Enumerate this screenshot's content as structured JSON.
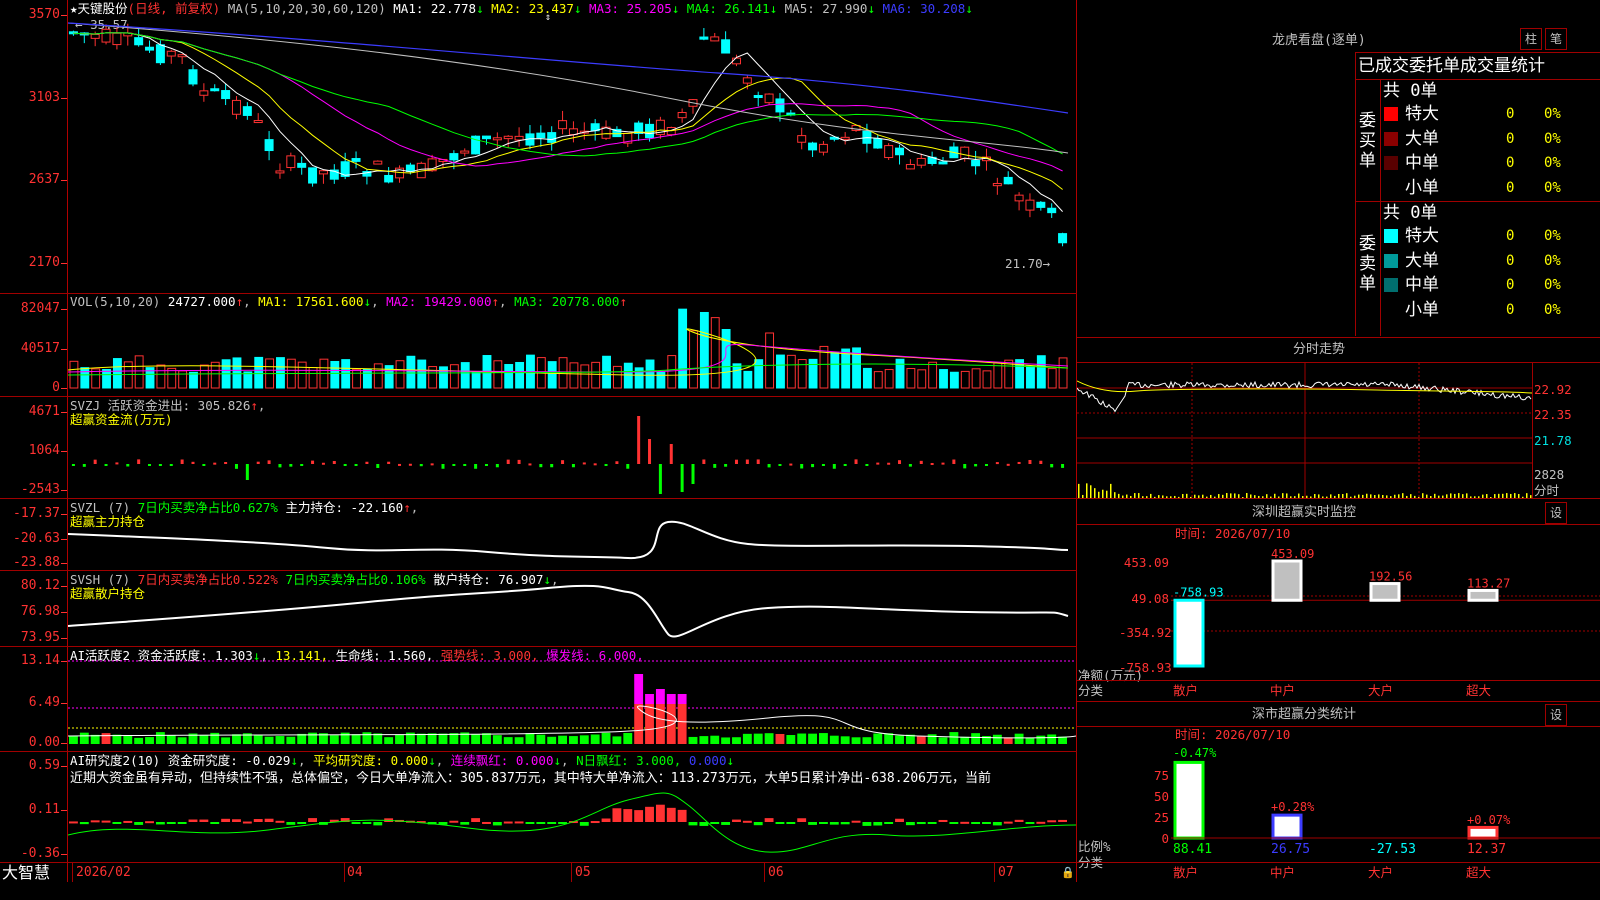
{
  "stock": {
    "name": "天键股份",
    "mode": "(日线, 前复权)",
    "ma_params": "MA(5,10,20,30,60,120)",
    "ma": [
      {
        "label": "MA1:",
        "value": "22.778",
        "arrow": "↓",
        "color": "#ffffff"
      },
      {
        "label": "MA2:",
        "value": "23.437",
        "arrow": "↓",
        "color": "#ffff00"
      },
      {
        "label": "MA3:",
        "value": "25.205",
        "arrow": "↓",
        "color": "#ff00ff"
      },
      {
        "label": "MA4:",
        "value": "26.141",
        "arrow": "↓",
        "color": "#00ff00"
      },
      {
        "label": "MA5:",
        "value": "27.990",
        "arrow": "↓",
        "color": "#c0c0c0"
      },
      {
        "label": "MA6:",
        "value": "30.208",
        "arrow": "↓",
        "color": "#3c3cff"
      }
    ],
    "high_mark": "35.57",
    "low_mark": "21.70→"
  },
  "main_axis": [
    "3570",
    "3103",
    "2637",
    "2170"
  ],
  "vol": {
    "header": "VOL(5,10,20)",
    "value": "24727.000",
    "ma1": "MA1: 17561.600",
    "ma2": "MA2: 19429.000",
    "ma3": "MA3: 20778.000",
    "axis": [
      "82047",
      "40517",
      "0"
    ]
  },
  "svzj": {
    "header": "SVZJ  活跃资金进出: 305.826",
    "title": "超赢资金流(万元)",
    "axis": [
      "4671",
      "1064",
      "-2543"
    ]
  },
  "svzl": {
    "header_a": "SVZL (7)",
    "header_b": "7日内买卖净占比0.627%",
    "header_c": "主力持仓: -22.160",
    "title": "超赢主力持仓",
    "axis": [
      "-17.37",
      "-20.63",
      "-23.88"
    ]
  },
  "svsh": {
    "header_a": "SVSH (7)",
    "header_b": "7日内买卖净占比0.522%",
    "header_c": "7日内买卖净占比0.106%",
    "header_d": "散户持仓: 76.907",
    "title": "超赢散户持仓",
    "axis": [
      "80.12",
      "76.98",
      "73.95"
    ]
  },
  "ai_active": {
    "a": "AI活跃度2 资金活跃度: 1.303",
    "b": "13.141,",
    "c": "生命线: 1.560,",
    "d": "强势线: 3.000,",
    "e": "爆发线: 6.000,",
    "axis": [
      "13.14",
      "6.49",
      "0.00"
    ]
  },
  "ai_research": {
    "a": "AI研究度2(10) 资金研究度: -0.029",
    "b": "平均研究度: 0.000",
    "c": "连续飘红: 0.000",
    "d": "N日飘红: 3.000,",
    "e": "0.000",
    "text": "近期大资金虽有异动，但持续性不强，总体偏空，今日大单净流入：305.837万元，其中特大单净流入：113.273万元，大单5日累计净出-638.206万元，当前",
    "axis": [
      "0.59",
      "0.11",
      "-0.36"
    ]
  },
  "dates": [
    "2026/02",
    "04",
    "05",
    "06",
    "07"
  ],
  "brand": "大智慧",
  "lhb": {
    "title": "龙虎看盘(逐单)",
    "btn1": "柱",
    "btn2": "笔",
    "subtitle": "已成交委托单成交量统计",
    "buy_group": "委买单",
    "sell_group": "委卖单",
    "buy_total": "共 0单",
    "sell_total": "共 0单",
    "buy_rows": [
      {
        "label": "特大",
        "count": "0",
        "pct": "0%",
        "color": "#ff0000"
      },
      {
        "label": "大单",
        "count": "0",
        "pct": "0%",
        "color": "#8b0000"
      },
      {
        "label": "中单",
        "count": "0",
        "pct": "0%",
        "color": "#5a0000"
      },
      {
        "label": "小单",
        "count": "0",
        "pct": "0%",
        "color": "#000000"
      }
    ],
    "sell_rows": [
      {
        "label": "特大",
        "count": "0",
        "pct": "0%",
        "color": "#00ffff"
      },
      {
        "label": "大单",
        "count": "0",
        "pct": "0%",
        "color": "#009a9a"
      },
      {
        "label": "中单",
        "count": "0",
        "pct": "0%",
        "color": "#006e6e"
      },
      {
        "label": "小单",
        "count": "0",
        "pct": "0%",
        "color": "#000000"
      }
    ]
  },
  "intraday": {
    "title": "分时走势",
    "axis": [
      "22.92",
      "22.35",
      "21.78"
    ],
    "vol_label": "2828",
    "unit": "分时"
  },
  "sz_monitor": {
    "title": "深圳超赢实时监控",
    "btn": "设",
    "time": "时间: 2026/07/10",
    "axis": [
      "453.09",
      "49.08",
      "-354.92",
      "-758.93"
    ],
    "y_unit_1": "净额(万元)",
    "y_unit_2": "分类",
    "categories": [
      "散户",
      "中户",
      "大户",
      "超大"
    ],
    "values": [
      "-758.93",
      "453.09",
      "192.56",
      "113.27"
    ]
  },
  "sz_class": {
    "title": "深市超赢分类统计",
    "btn": "设",
    "time": "时间: 2026/07/10",
    "axis": [
      "75",
      "50",
      "25",
      "0"
    ],
    "y_unit_1": "比例%",
    "y_unit_2": "分类",
    "categories": [
      "散户",
      "中户",
      "大户",
      "超大"
    ],
    "top": [
      "-0.47%",
      "+0.28%",
      "",
      "+0.07%"
    ],
    "bottom": [
      "88.41",
      "26.75",
      "-27.53",
      "12.37"
    ]
  },
  "chart_data": {
    "type": "bar",
    "title": "深圳超赢实时监控",
    "categories": [
      "散户",
      "中户",
      "大户",
      "超大"
    ],
    "values": [
      -758.93,
      453.09,
      192.56,
      113.27
    ],
    "ylabel": "净额(万元)",
    "ylim": [
      -758.93,
      453.09
    ]
  }
}
